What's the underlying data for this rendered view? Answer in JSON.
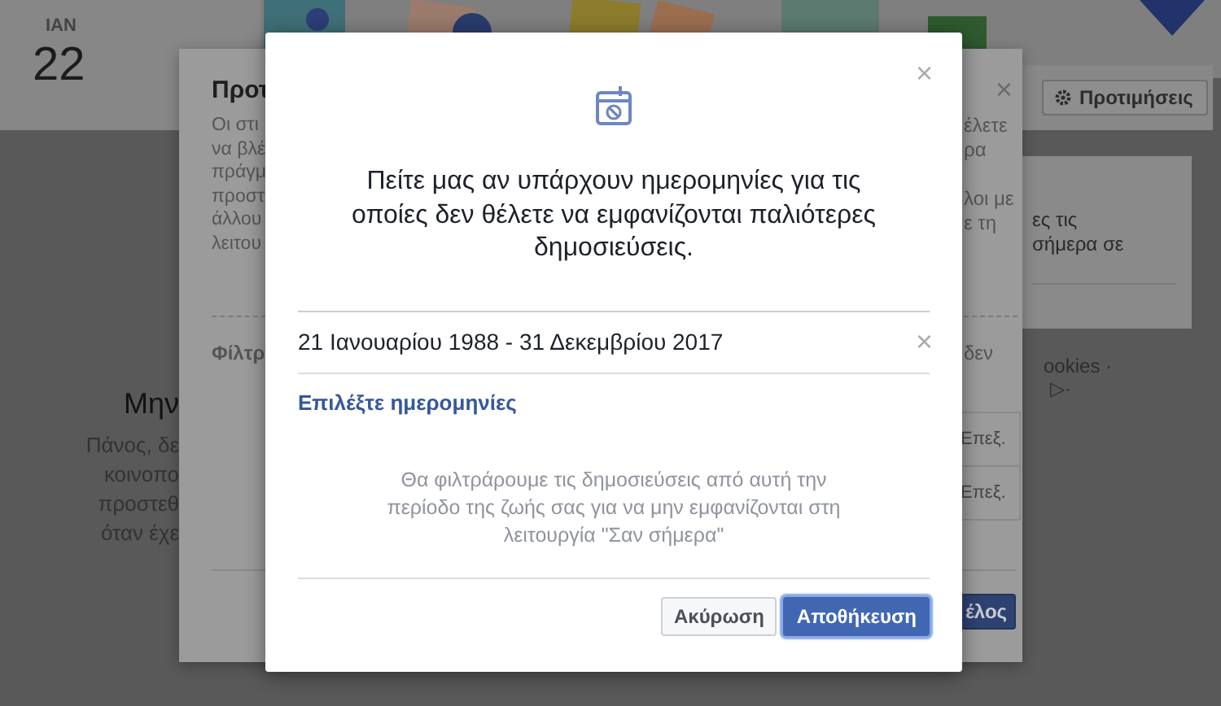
{
  "page": {
    "date_card": {
      "month": "ΙΑΝ",
      "day": "22"
    },
    "preferences_button": "Προτιμήσεις",
    "side_card_lines": [
      "ες τις",
      "σήμερα σε"
    ],
    "footer_fragments": [
      "ookies ·",
      "▷·"
    ],
    "empty_state": {
      "title": "Μην",
      "lines": [
        "Πάνος, δε",
        "κοινοπο",
        "προστεθ",
        "όταν έχε"
      ]
    }
  },
  "preferences_dialog": {
    "title": "Προτ",
    "close": "×",
    "text_left": [
      "Οι στι",
      "να βλέ",
      "πράγμ",
      "προστ",
      "άλλου",
      "λειτου"
    ],
    "text_right": [
      "έλετε",
      "ρα",
      "λοι με",
      "ε τη"
    ],
    "filter_label": "Φίλτρ",
    "filter_right": "δεν",
    "rows": [
      {
        "edit": "Επεξ."
      },
      {
        "edit": "Επεξ."
      }
    ],
    "button": "έλος"
  },
  "date_dialog": {
    "close": "×",
    "message": "Πείτε μας αν υπάρχουν ημερομηνίες για τις οποίες δεν θέλετε να εμφανίζονται παλιότερες δημοσιεύσεις.",
    "date_range": {
      "value": "21 Ιανουαρίου 1988 - 31 Δεκεμβρίου 2017",
      "clear": "×"
    },
    "choose_dates_link": "Επιλέξτε ημερομηνίες",
    "note": "Θα φιλτράρουμε τις δημοσιεύσεις από αυτή την περίοδο της ζωής σας για να μην εμφανίζονται στη λειτουργία \"Σαν σήμερα\"",
    "buttons": [
      {
        "label": "Ακύρωση",
        "kind": "secondary"
      },
      {
        "label": "Αποθήκευση",
        "kind": "primary"
      }
    ]
  }
}
